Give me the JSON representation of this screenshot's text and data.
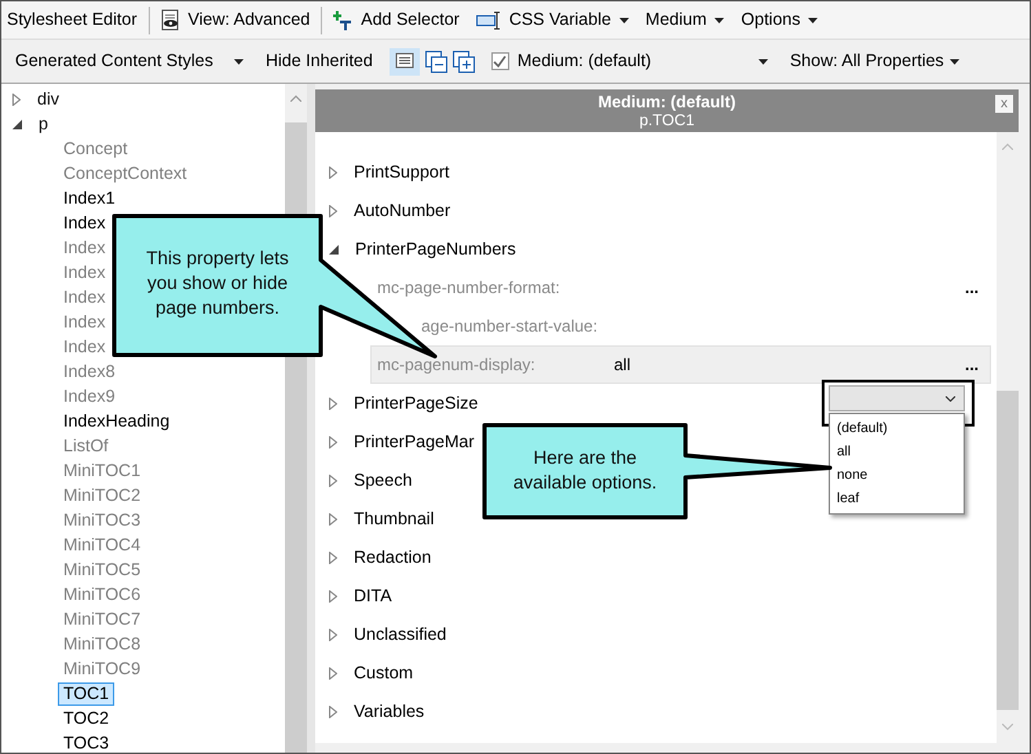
{
  "toolbar": {
    "title": "Stylesheet Editor",
    "items": [
      {
        "kind": "view",
        "label": "View: Advanced",
        "dropdown": false
      },
      {
        "kind": "add",
        "label": "Add Selector",
        "dropdown": false
      },
      {
        "kind": "variable",
        "label": "CSS Variable",
        "dropdown": true
      },
      {
        "kind": "plain",
        "label": "Medium",
        "dropdown": true
      },
      {
        "kind": "plain",
        "label": "Options",
        "dropdown": true
      }
    ]
  },
  "filterbar": {
    "styles": "Generated Content Styles",
    "hide_inherited": "Hide Inherited",
    "medium_checked": true,
    "medium": "Medium: (default)",
    "show": "Show: All Properties"
  },
  "tree": [
    {
      "label": "div",
      "expanded": false
    },
    {
      "label": "p",
      "expanded": true,
      "children": [
        {
          "label": "Concept",
          "dimmed": true,
          "selected": false
        },
        {
          "label": "ConceptContext",
          "dimmed": true,
          "selected": false
        },
        {
          "label": "Index1",
          "dimmed": false,
          "selected": false
        },
        {
          "label": "Index",
          "dimmed": false,
          "selected": false
        },
        {
          "label": "Index",
          "dimmed": true,
          "selected": false
        },
        {
          "label": "Index",
          "dimmed": true,
          "selected": false
        },
        {
          "label": "Index",
          "dimmed": true,
          "selected": false
        },
        {
          "label": "Index",
          "dimmed": true,
          "selected": false
        },
        {
          "label": "Index",
          "dimmed": true,
          "selected": false
        },
        {
          "label": "Index8",
          "dimmed": true,
          "selected": false
        },
        {
          "label": "Index9",
          "dimmed": true,
          "selected": false
        },
        {
          "label": "IndexHeading",
          "dimmed": false,
          "selected": false
        },
        {
          "label": "ListOf",
          "dimmed": true,
          "selected": false
        },
        {
          "label": "MiniTOC1",
          "dimmed": true,
          "selected": false
        },
        {
          "label": "MiniTOC2",
          "dimmed": true,
          "selected": false
        },
        {
          "label": "MiniTOC3",
          "dimmed": true,
          "selected": false
        },
        {
          "label": "MiniTOC4",
          "dimmed": true,
          "selected": false
        },
        {
          "label": "MiniTOC5",
          "dimmed": true,
          "selected": false
        },
        {
          "label": "MiniTOC6",
          "dimmed": true,
          "selected": false
        },
        {
          "label": "MiniTOC7",
          "dimmed": true,
          "selected": false
        },
        {
          "label": "MiniTOC8",
          "dimmed": true,
          "selected": false
        },
        {
          "label": "MiniTOC9",
          "dimmed": true,
          "selected": false
        },
        {
          "label": "TOC1",
          "dimmed": false,
          "selected": true
        },
        {
          "label": "TOC2",
          "dimmed": false,
          "selected": false
        },
        {
          "label": "TOC3",
          "dimmed": false,
          "selected": false
        }
      ]
    }
  ],
  "panel": {
    "title": "Medium: (default)",
    "subtitle": "p.TOC1",
    "close": "x",
    "groups": [
      {
        "label": "PrintSupport",
        "expanded": false
      },
      {
        "label": "AutoNumber",
        "expanded": false
      },
      {
        "label": "PrinterPageNumbers",
        "expanded": true,
        "properties": [
          {
            "name": "mc-page-number-format:",
            "more": "...",
            "highlighted": false
          },
          {
            "name": "age-number-start-value:",
            "highlighted": false
          },
          {
            "name": "mc-pagenum-display:",
            "value": "all",
            "more": "...",
            "highlighted": true
          }
        ]
      },
      {
        "label": "PrinterPageSize",
        "expanded": false
      },
      {
        "label": "PrinterPageMar",
        "expanded": false
      },
      {
        "label": "Speech",
        "expanded": false
      },
      {
        "label": "Thumbnail",
        "expanded": false
      },
      {
        "label": "Redaction",
        "expanded": false
      },
      {
        "label": "DITA",
        "expanded": false
      },
      {
        "label": "Unclassified",
        "expanded": false
      },
      {
        "label": "Custom",
        "expanded": false
      },
      {
        "label": "Variables",
        "expanded": false
      }
    ],
    "options": [
      "(default)",
      "all",
      "none",
      "leaf"
    ]
  },
  "callouts": [
    {
      "text": "This property lets you show or hide page numbers."
    },
    {
      "text": "Here are the available options."
    }
  ]
}
